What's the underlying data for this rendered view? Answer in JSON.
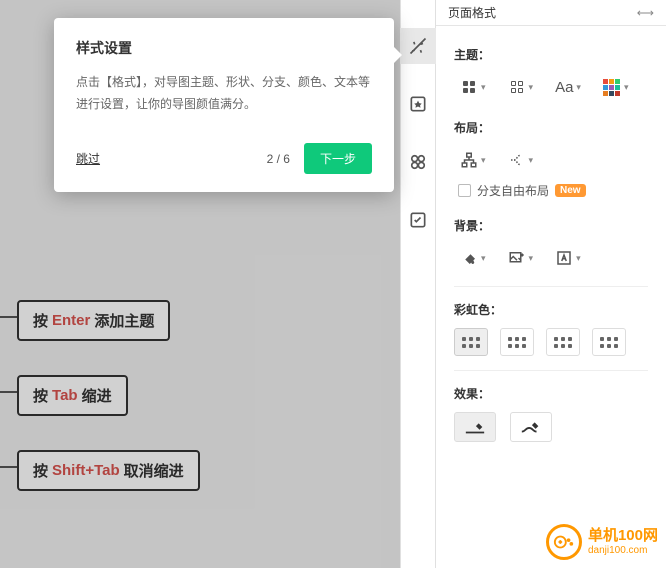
{
  "canvas": {
    "nodes": [
      {
        "prefix": "按 ",
        "key": "Enter",
        "suffix": " 添加主题"
      },
      {
        "prefix": "按 ",
        "key": "Tab",
        "suffix": " 缩进"
      },
      {
        "prefix": "按 ",
        "key": "Shift+Tab",
        "suffix": " 取消缩进"
      }
    ]
  },
  "tooltip": {
    "title": "样式设置",
    "body": "点击【格式】，对导图主题、形状、分支、颜色、文本等进行设置，让你的导图颜值满分。",
    "skip": "跳过",
    "step": "2 / 6",
    "next": "下一步"
  },
  "panel": {
    "header": "页面格式",
    "sections": {
      "theme": "主题：",
      "layout": "布局：",
      "freeLayout": "分支自由布局",
      "newBadge": "New",
      "background": "背景：",
      "rainbow": "彩虹色：",
      "effect": "效果："
    },
    "font_label": "Aa"
  },
  "watermark": {
    "cn": "单机100网",
    "en": "danji100.com"
  }
}
